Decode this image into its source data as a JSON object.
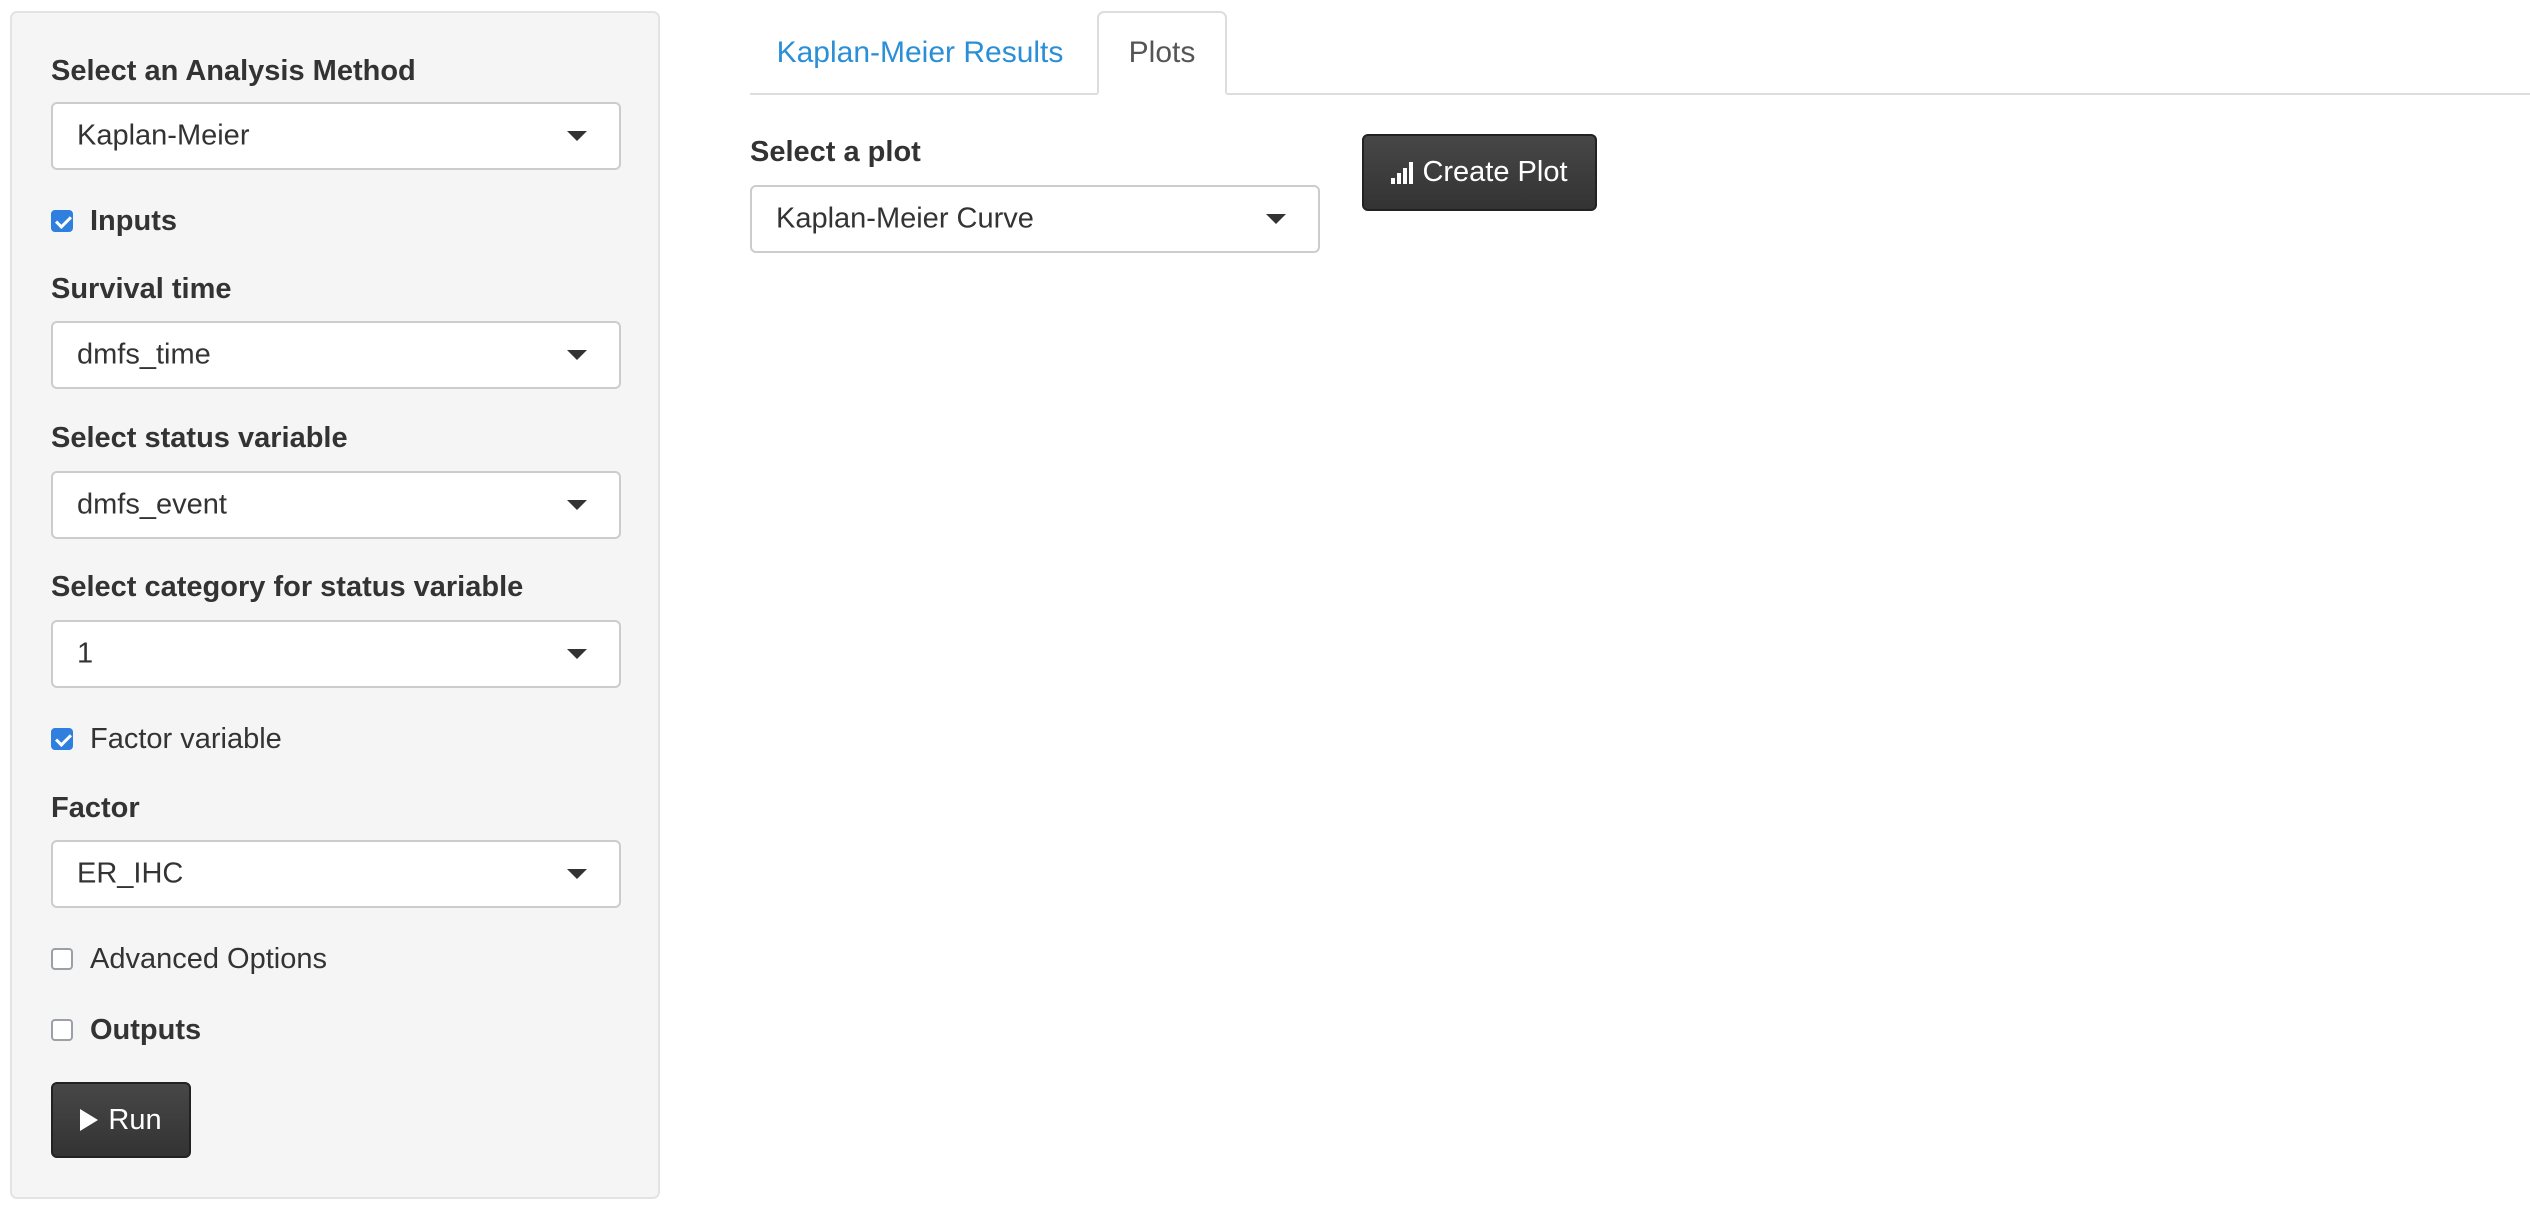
{
  "sidebar": {
    "analysis_method": {
      "label": "Select an Analysis Method",
      "value": "Kaplan-Meier"
    },
    "inputs_checkbox": {
      "label": "Inputs",
      "checked": true
    },
    "survival_time": {
      "label": "Survival time",
      "value": "dmfs_time"
    },
    "status_variable": {
      "label": "Select status variable",
      "value": "dmfs_event"
    },
    "status_category": {
      "label": "Select category for status variable",
      "value": "1"
    },
    "factor_variable_checkbox": {
      "label": "Factor variable",
      "checked": true
    },
    "factor": {
      "label": "Factor",
      "value": "ER_IHC"
    },
    "advanced_options_checkbox": {
      "label": "Advanced Options",
      "checked": false
    },
    "outputs_checkbox": {
      "label": "Outputs",
      "checked": false
    },
    "run_button": {
      "label": "Run",
      "icon": "play-icon"
    }
  },
  "tabs": [
    {
      "label": "Kaplan-Meier Results",
      "active": false
    },
    {
      "label": "Plots",
      "active": true
    }
  ],
  "plots_panel": {
    "select_plot": {
      "label": "Select a plot",
      "value": "Kaplan-Meier Curve"
    },
    "create_plot_button": {
      "label": "Create Plot",
      "icon": "bar-chart-icon"
    }
  },
  "colors": {
    "tab_link": "#2a8fd6",
    "checkbox_checked": "#2f7fdf",
    "button_dark": "#3d3d3d",
    "sidebar_bg": "#f5f5f5"
  }
}
